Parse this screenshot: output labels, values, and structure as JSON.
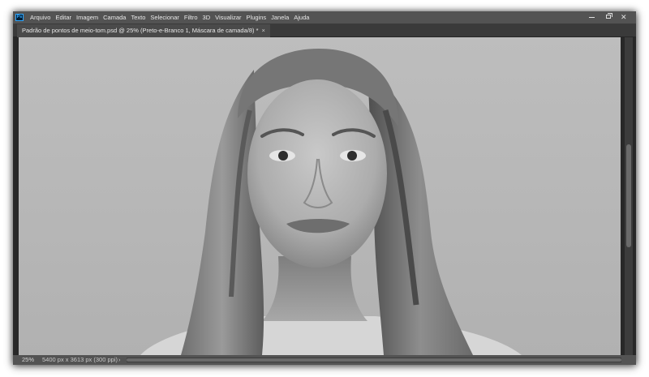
{
  "app": {
    "logo_text": "Ps",
    "menu": [
      "Arquivo",
      "Editar",
      "Imagem",
      "Camada",
      "Texto",
      "Selecionar",
      "Filtro",
      "3D",
      "Visualizar",
      "Plugins",
      "Janela",
      "Ajuda"
    ]
  },
  "window_controls": {
    "minimize_icon": "minimize-icon",
    "restore_icon": "restore-icon",
    "close_icon": "close-icon",
    "close_glyph": "✕"
  },
  "document": {
    "tab_title": "Padrão de pontos de meio-tom.psd @ 25% (Preto-e-Branco 1, Máscara de camada/8) *",
    "tab_close_glyph": "×"
  },
  "canvas": {
    "image_description_icon": "photo-portrait",
    "grayscale": true
  },
  "status": {
    "zoom": "25%",
    "doc_size": "5400 px x 3613 px (300 ppi)",
    "arrow": "›"
  },
  "colors": {
    "panel_bg": "#535353",
    "workspace_bg": "#282828",
    "canvas_bg": "#b8b8b8",
    "tab_bg": "#4a4a4a",
    "ps_blue": "#31a8ff"
  }
}
